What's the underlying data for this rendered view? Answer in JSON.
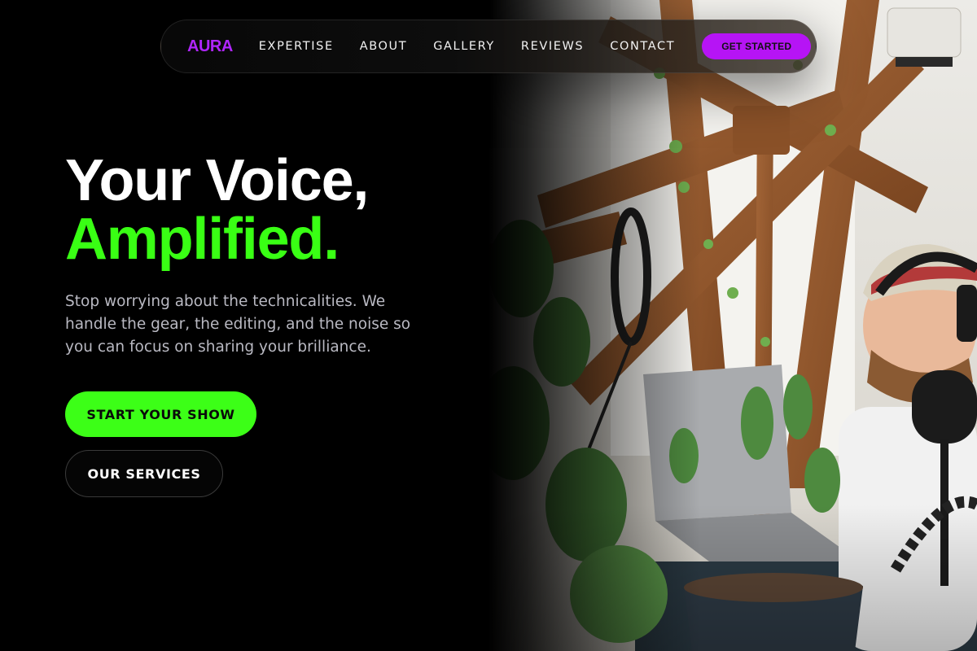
{
  "nav": {
    "logo": "AURA",
    "links": [
      {
        "label": "EXPERTISE"
      },
      {
        "label": "ABOUT"
      },
      {
        "label": "GALLERY"
      },
      {
        "label": "REVIEWS"
      },
      {
        "label": "CONTACT"
      }
    ],
    "cta_label": "GET STARTED"
  },
  "hero": {
    "headline_line1": "Your Voice,",
    "headline_line2": "Amplified.",
    "subcopy": "Stop worrying about the technicalities. We handle the gear, the editing, and the noise so you can focus on sharing your brilliance.",
    "primary_button": "START YOUR SHOW",
    "secondary_button": "OUR SERVICES"
  },
  "colors": {
    "brand_purple": "#b026ff",
    "accent_green": "#39ff14",
    "background": "#000000"
  },
  "photo": {
    "subject": "podcast-host-with-microphone-and-laptop"
  }
}
